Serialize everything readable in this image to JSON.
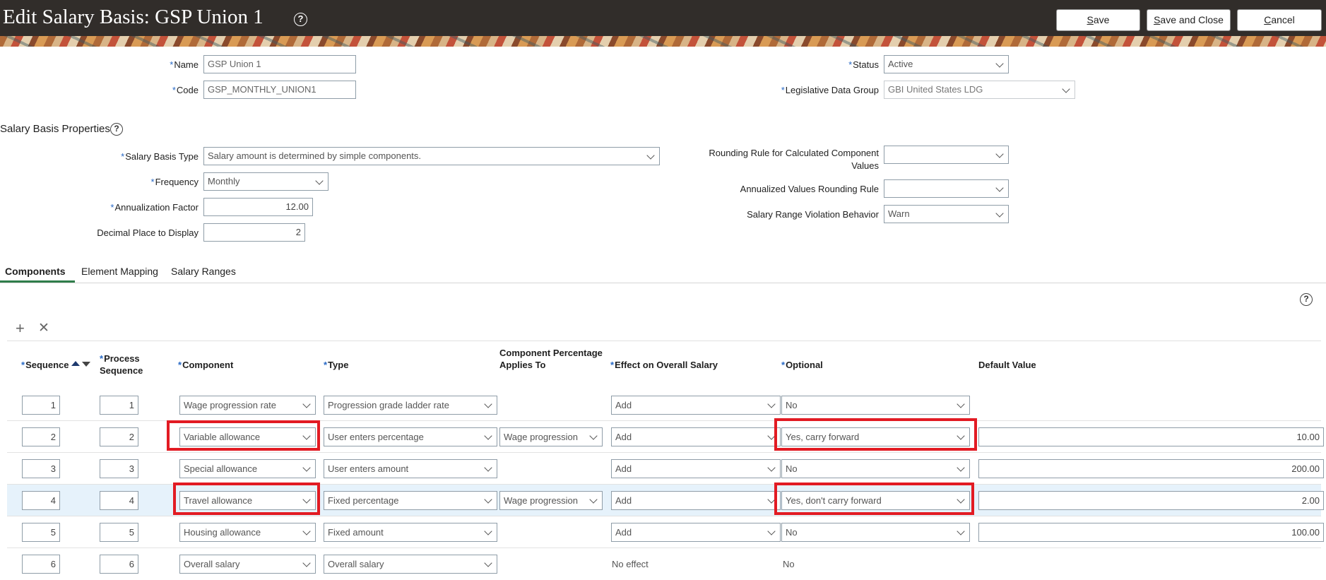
{
  "header": {
    "title": "Edit Salary Basis: GSP Union 1",
    "help_glyph": "?",
    "buttons": [
      {
        "key": "S",
        "rest": "ave"
      },
      {
        "key": "S",
        "rest": "ave and Close"
      },
      {
        "key": "C",
        "rest": "ancel"
      }
    ]
  },
  "form": {
    "required_mark": "*",
    "name": {
      "label": "Name",
      "value": "GSP Union 1"
    },
    "code": {
      "label": "Code",
      "value": "GSP_MONTHLY_UNION1"
    },
    "status": {
      "label": "Status",
      "value": "Active"
    },
    "ldg": {
      "label": "Legislative Data Group",
      "value": "GBI United States LDG"
    }
  },
  "properties": {
    "title": "Salary Basis Properties",
    "help_glyph": "?",
    "salary_basis_type": {
      "label": "Salary Basis Type",
      "value": "Salary amount is determined by simple components."
    },
    "frequency": {
      "label": "Frequency",
      "value": "Monthly"
    },
    "annualization_factor": {
      "label": "Annualization Factor",
      "value": "12.00"
    },
    "decimal_place": {
      "label": "Decimal Place to Display",
      "value": "2"
    },
    "rounding_rule": {
      "label": "Rounding Rule for Calculated Component Values",
      "value": ""
    },
    "annualized_rounding": {
      "label": "Annualized Values Rounding Rule",
      "value": ""
    },
    "range_violation": {
      "label": "Salary Range Violation Behavior",
      "value": "Warn"
    }
  },
  "tabs": [
    "Components",
    "Element Mapping",
    "Salary Ranges"
  ],
  "table": {
    "help_glyph": "?",
    "add_glyph": "+",
    "delete_glyph": "✕",
    "headers": {
      "sequence": "Sequence",
      "process_sequence": "Process Sequence",
      "component": "Component",
      "type": "Type",
      "percentage_applies": "Component Percentage Applies To",
      "effect": "Effect on Overall Salary",
      "optional": "Optional",
      "default_value": "Default Value"
    },
    "rows": [
      {
        "seq": "1",
        "proc": "1",
        "component": "Wage progression rate",
        "type": "Progression grade ladder rate",
        "applies": "",
        "effect": "Add",
        "optional": "No",
        "default": ""
      },
      {
        "seq": "2",
        "proc": "2",
        "component": "Variable allowance",
        "type": "User enters percentage",
        "applies": "Wage progression",
        "effect": "Add",
        "optional": "Yes, carry forward",
        "default": "10.00"
      },
      {
        "seq": "3",
        "proc": "3",
        "component": "Special allowance",
        "type": "User enters amount",
        "applies": "",
        "effect": "Add",
        "optional": "No",
        "default": "200.00"
      },
      {
        "seq": "4",
        "proc": "4",
        "component": "Travel allowance",
        "type": "Fixed percentage",
        "applies": "Wage progression",
        "effect": "Add",
        "optional": "Yes, don't carry forward",
        "default": "2.00"
      },
      {
        "seq": "5",
        "proc": "5",
        "component": "Housing allowance",
        "type": "Fixed amount",
        "applies": "",
        "effect": "Add",
        "optional": "No",
        "default": "100.00"
      },
      {
        "seq": "6",
        "proc": "6",
        "component": "Overall salary",
        "type": "Overall salary",
        "applies": "",
        "effect": "No effect",
        "optional": "No",
        "default": ""
      }
    ]
  },
  "colors": {
    "header_bg": "#312d2a",
    "highlight_row": "#e6f2fb",
    "annotation_box": "#e21b23",
    "required": "#2869c5"
  }
}
